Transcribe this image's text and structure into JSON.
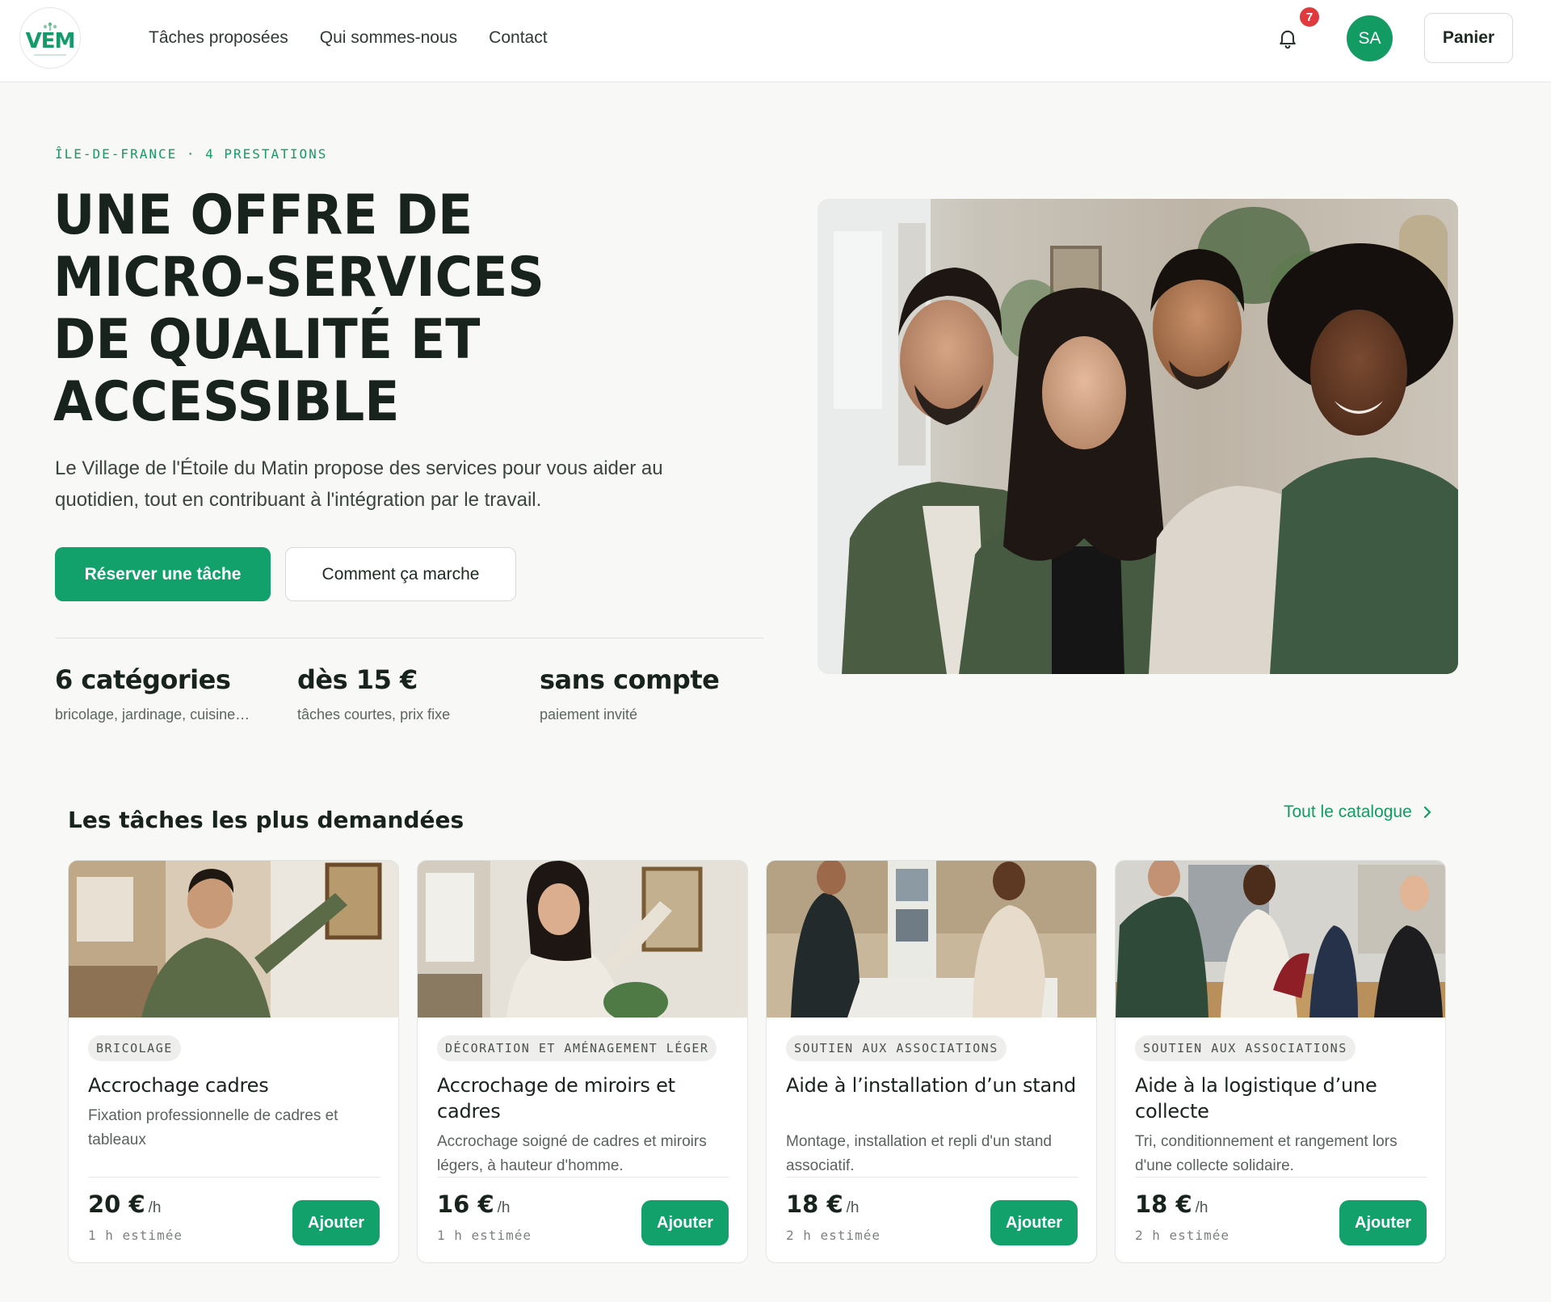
{
  "header": {
    "logo_text": "VEM",
    "nav": [
      "Tâches proposées",
      "Qui sommes-nous",
      "Contact"
    ],
    "notification_count": "7",
    "avatar_initials": "SA",
    "cart_label": "Panier"
  },
  "hero": {
    "eyebrow": "ÎLE-DE-FRANCE · 4 PRESTATIONS",
    "title": "UNE OFFRE DE MICRO-SERVICES DE QUALITÉ ET ACCESSIBLE",
    "description": "Le Village de l'Étoile du Matin propose des services pour vous aider au quotidien, tout en contribuant à l'intégration par le travail.",
    "primary_cta": "Réserver une tâche",
    "secondary_cta": "Comment ça marche",
    "stats": [
      {
        "value": "6 catégories",
        "label": "bricolage, jardinage, cuisine…"
      },
      {
        "value": "dès 15 €",
        "label": "tâches courtes, prix fixe"
      },
      {
        "value": "sans compte",
        "label": "paiement invité"
      }
    ]
  },
  "popular": {
    "title": "Les tâches les plus demandées",
    "catalog_link": "Tout le catalogue",
    "cards": [
      {
        "category": "BRICOLAGE",
        "title": "Accrochage cadres",
        "description": "Fixation professionnelle de cadres et tableaux",
        "price": "20 €",
        "unit": "/h",
        "duration": "1 h estimée",
        "add_label": "Ajouter"
      },
      {
        "category": "DÉCORATION ET AMÉNAGEMENT LÉGER",
        "title": "Accrochage de miroirs et cadres",
        "description": "Accrochage soigné de cadres et miroirs légers, à hauteur d'homme.",
        "price": "16 €",
        "unit": "/h",
        "duration": "1 h estimée",
        "add_label": "Ajouter"
      },
      {
        "category": "SOUTIEN AUX ASSOCIATIONS",
        "title": "Aide à l’installation d’un stand",
        "description": "Montage, installation et repli d'un stand associatif.",
        "price": "18 €",
        "unit": "/h",
        "duration": "2 h estimée",
        "add_label": "Ajouter"
      },
      {
        "category": "SOUTIEN AUX ASSOCIATIONS",
        "title": "Aide à la logistique d’une collecte",
        "description": "Tri, conditionnement et rangement lors d'une collecte solidaire.",
        "price": "18 €",
        "unit": "/h",
        "duration": "2 h estimée",
        "add_label": "Ajouter"
      }
    ]
  },
  "colors": {
    "accent": "#12a06b",
    "text_dark": "#17231c",
    "badge": "#e0393e",
    "background": "#f8f8f6"
  },
  "icons": [
    "sprout-icon",
    "bell-icon",
    "chevron-right-icon"
  ]
}
